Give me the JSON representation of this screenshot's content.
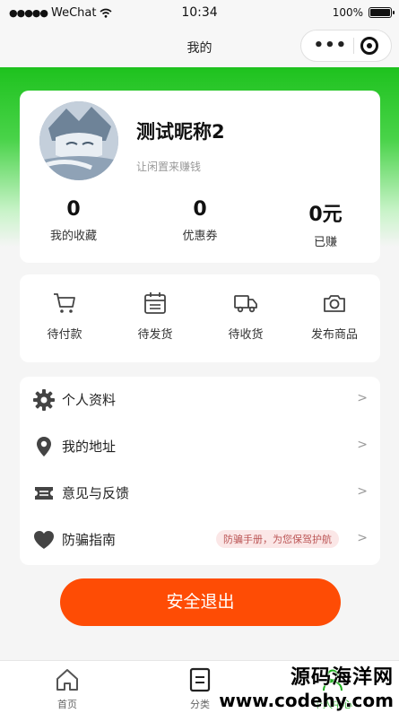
{
  "status_bar": {
    "carrier": "WeChat",
    "time": "10:34",
    "battery": "100%",
    "battery_level": 1.0
  },
  "nav": {
    "title": "我的",
    "more_icon": "more-dots-icon",
    "close_icon": "target-icon"
  },
  "profile": {
    "nickname": "测试昵称2",
    "subtitle": "让闲置来赚钱"
  },
  "stats": [
    {
      "value": "0",
      "label": "我的收藏"
    },
    {
      "value": "0",
      "label": "优惠券"
    },
    {
      "value": "0元",
      "label": "已赚"
    }
  ],
  "orders": [
    {
      "label": "待付款",
      "icon": "cart-icon"
    },
    {
      "label": "待发货",
      "icon": "calendar-icon"
    },
    {
      "label": "待收货",
      "icon": "truck-icon"
    },
    {
      "label": "发布商品",
      "icon": "camera-icon"
    }
  ],
  "menu": [
    {
      "label": "个人资料",
      "icon": "gear-icon",
      "arrow": ">"
    },
    {
      "label": "我的地址",
      "icon": "location-pin-icon",
      "arrow": ">"
    },
    {
      "label": "意见与反馈",
      "icon": "ticket-icon",
      "arrow": ">"
    },
    {
      "label": "防骗指南",
      "icon": "heart-icon",
      "arrow": ">",
      "tag": "防骗手册，为您保驾护航"
    }
  ],
  "logout_label": "安全退出",
  "tabs": [
    {
      "label": "首页",
      "icon": "home-icon"
    },
    {
      "label": "分类",
      "icon": "category-icon"
    },
    {
      "label": "个人中心",
      "icon": "user-icon"
    }
  ],
  "watermark": {
    "line1": "源码海洋网",
    "line2": "www.codehy.com"
  },
  "colors": {
    "accent_green": "#1ec21e",
    "logout_orange": "#fe4c05",
    "active_tab": "#19ad19"
  }
}
